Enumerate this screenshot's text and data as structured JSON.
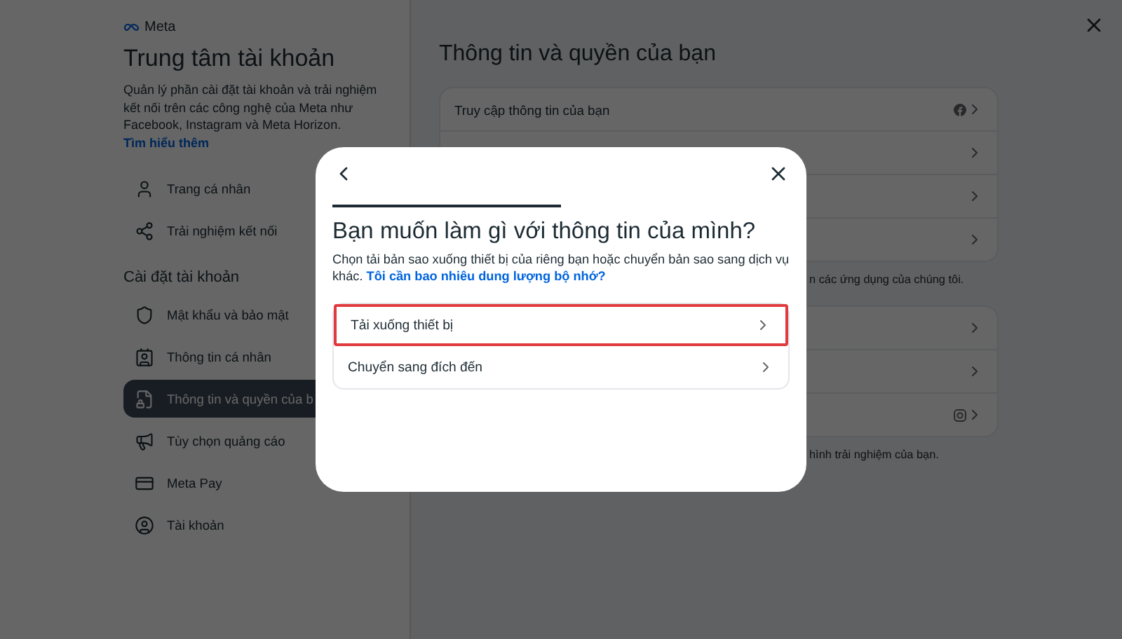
{
  "sidebar": {
    "brand": "Meta",
    "title": "Trung tâm tài khoản",
    "description": "Quản lý phần cài đặt tài khoản và trải nghiệm kết nối trên các công nghệ của Meta như Facebook, Instagram và Meta Horizon.",
    "link": "Tìm hiểu thêm",
    "items": [
      {
        "label": "Trang cá nhân",
        "selected": false
      },
      {
        "label": "Trải nghiệm kết nối",
        "selected": false
      }
    ],
    "section": "Cài đặt tài khoản",
    "settings_items": [
      {
        "label": "Mật khẩu và bảo mật",
        "selected": false
      },
      {
        "label": "Thông tin cá nhân",
        "selected": false
      },
      {
        "label": "Thông tin và quyền của b",
        "selected": true
      },
      {
        "label": "Tùy chọn quảng cáo",
        "selected": false
      },
      {
        "label": "Meta Pay",
        "selected": false
      },
      {
        "label": "Tài khoản",
        "selected": false
      }
    ]
  },
  "main": {
    "title": "Thông tin và quyền của bạn",
    "groups": [
      {
        "rows": [
          {
            "label": "Truy cập thông tin của bạn",
            "kind": "facebook"
          },
          {
            "kind": "plain"
          },
          {
            "kind": "plain"
          },
          {
            "kind": "plain"
          }
        ],
        "note": "n các ứng dụng của chúng tôi."
      },
      {
        "rows": [
          {
            "kind": "plain"
          },
          {
            "kind": "plain"
          },
          {
            "kind": "instagram"
          }
        ],
        "note": "hình trải nghiệm của bạn."
      }
    ]
  },
  "dialog": {
    "title": "Bạn muốn làm gì với thông tin của mình?",
    "description": "Chọn tải bản sao xuống thiết bị của riêng bạn hoặc chuyển bản sao sang dịch vụ khác.",
    "link": "Tôi cần bao nhiêu dung lượng bộ nhớ?",
    "options": [
      {
        "label": "Tải xuống thiết bị",
        "highlighted": true
      },
      {
        "label": "Chuyển sang đích đến",
        "highlighted": false
      }
    ]
  }
}
